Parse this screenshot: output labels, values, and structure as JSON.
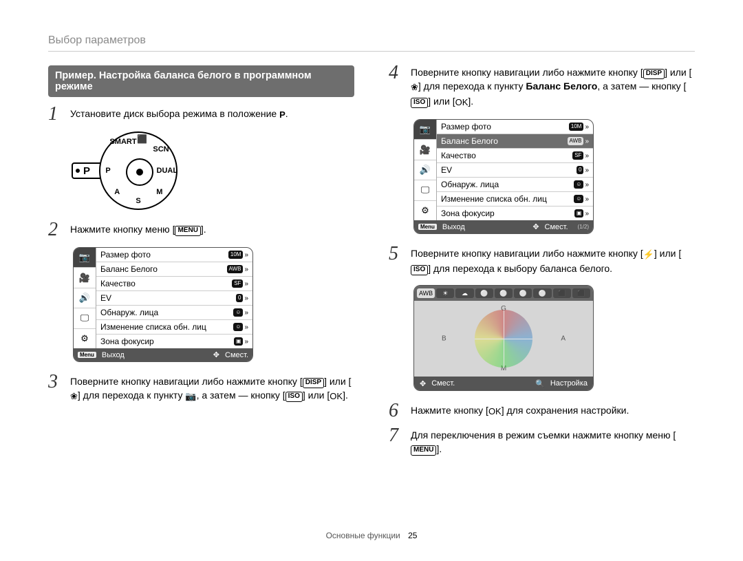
{
  "running_head": "Выбор параметров",
  "callout": "Пример. Настройка баланса белого в программном режиме",
  "steps": {
    "1": {
      "num": "1",
      "text_a": "Установите диск выбора режима в положение ",
      "tag_p": "P",
      "text_b": "."
    },
    "2": {
      "num": "2",
      "text_a": "Нажмите кнопку меню [",
      "tag_menu": "MENU",
      "text_b": "]."
    },
    "3": {
      "num": "3",
      "text_a": "Поверните кнопку навигации либо нажмите кнопку [",
      "tag_disp": "DISP",
      "text_b": "] или [",
      "sym_macro": "❀",
      "text_c": "] для перехода к пункту ",
      "sym_cam": "📷",
      "text_d": ", а затем — кнопку [",
      "tag_iso": "ISO",
      "text_e": "] или [",
      "sym_ok": "OK",
      "text_f": "]."
    },
    "4": {
      "num": "4",
      "text_a": "Поверните кнопку навигации либо нажмите кнопку [",
      "tag_disp": "DISP",
      "text_b": "] или [",
      "sym_macro": "❀",
      "text_c": "] для перехода к пункту ",
      "bold": "Баланс Белого",
      "text_d": ", а затем — кнопку [",
      "tag_iso": "ISO",
      "text_e": "] или [",
      "sym_ok": "OK",
      "text_f": "]."
    },
    "5": {
      "num": "5",
      "text_a": "Поверните кнопку навигации либо нажмите кнопку [",
      "sym_flash": "⚡",
      "text_b": "] или [",
      "tag_iso": "ISO",
      "text_c": "] для перехода к выбору баланса белого."
    },
    "6": {
      "num": "6",
      "text_a": "Нажмите кнопку [",
      "sym_ok": "OK",
      "text_b": "] для сохранения настройки."
    },
    "7": {
      "num": "7",
      "text_a": "Для переключения в режим съемки нажмите кнопку меню [",
      "tag_menu": "MENU",
      "text_b": "]."
    }
  },
  "dial": {
    "positions": [
      "SMART",
      "⬛",
      "SCN",
      "DUAL",
      "M",
      "S",
      "A",
      "P"
    ],
    "selected": "P"
  },
  "menu": {
    "side_icons": [
      "📷",
      "🎥",
      "🔊",
      "🖵",
      "⚙"
    ],
    "side_selected_index": 0,
    "rows": [
      {
        "label": "Размер фото",
        "val": "10M",
        "chev": "»"
      },
      {
        "label": "Баланс Белого",
        "val": "AWB",
        "chev": "»"
      },
      {
        "label": "Качество",
        "val": "SF",
        "chev": "»"
      },
      {
        "label": "EV",
        "val": "0",
        "chev": "»"
      },
      {
        "label": "Обнаруж. лица",
        "val": "☺",
        "chev": "»"
      },
      {
        "label": "Изменение списка обн. лиц",
        "val": "☺",
        "chev": "»"
      },
      {
        "label": "Зона фокусир",
        "val": "▣",
        "chev": "»"
      }
    ],
    "foot": {
      "menu_key": "Menu",
      "exit": "Выход",
      "shift_sym": "✥",
      "shift": "Смест.",
      "page": "(1/2)"
    },
    "selected_index_step2": 0,
    "selected_index_step4": 1
  },
  "wb": {
    "strip": [
      "AWB",
      "☀",
      "☁",
      "⚪",
      "⚪",
      "⚪",
      "⚪",
      "⬛",
      "⬛"
    ],
    "strip_selected_index": 0,
    "axes": {
      "g": "G",
      "m": "M",
      "b": "B",
      "a": "A"
    },
    "foot": {
      "shift_sym": "✥",
      "shift": "Смест.",
      "zoom_sym": "🔍",
      "tune": "Настройка"
    }
  },
  "footer": {
    "section": "Основные функции",
    "page": "25"
  }
}
